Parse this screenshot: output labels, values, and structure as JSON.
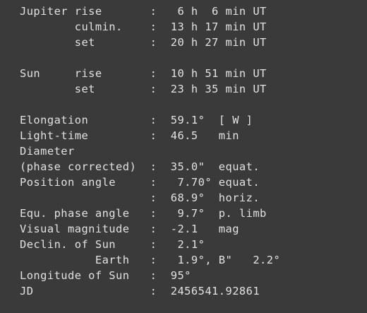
{
  "lines": [
    "Jupiter rise       :   6 h  6 min UT",
    "        culmin.    :  13 h 17 min UT",
    "        set        :  20 h 27 min UT",
    "",
    "Sun     rise       :  10 h 51 min UT",
    "        set        :  23 h 35 min UT",
    "",
    "Elongation         :  59.1°  [ W ]",
    "Light-time         :  46.5   min",
    "Diameter",
    "(phase corrected)  :  35.0\"  equat.",
    "Position angle     :   7.70° equat.",
    "                   :  68.9°  horiz.",
    "Equ. phase angle   :   9.7°  p. limb",
    "Visual magnitude   :  -2.1   mag",
    "Declin. of Sun     :   2.1°",
    "           Earth   :   1.9°, B\"   2.2°",
    "Longitude of Sun   :  95°",
    "JD                 :  2456541.92861"
  ]
}
